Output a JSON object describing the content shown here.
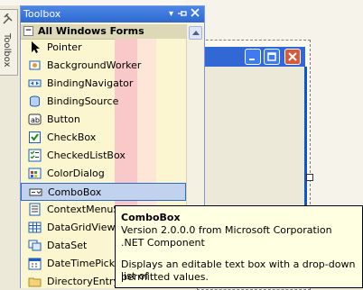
{
  "dock_tab": {
    "label": "Toolbox"
  },
  "toolbox": {
    "title": "Toolbox",
    "section": "All Windows Forms",
    "items": [
      {
        "label": "Pointer",
        "icon": "pointer-icon"
      },
      {
        "label": "BackgroundWorker",
        "icon": "background-worker-icon"
      },
      {
        "label": "BindingNavigator",
        "icon": "binding-navigator-icon"
      },
      {
        "label": "BindingSource",
        "icon": "binding-source-icon"
      },
      {
        "label": "Button",
        "icon": "button-icon"
      },
      {
        "label": "CheckBox",
        "icon": "checkbox-icon"
      },
      {
        "label": "CheckedListBox",
        "icon": "checked-listbox-icon"
      },
      {
        "label": "ColorDialog",
        "icon": "color-dialog-icon"
      },
      {
        "label": "ComboBox",
        "icon": "combobox-icon",
        "selected": true
      },
      {
        "label": "ContextMenuStrip",
        "icon": "context-menu-strip-icon"
      },
      {
        "label": "DataGridView",
        "icon": "datagridview-icon"
      },
      {
        "label": "DataSet",
        "icon": "dataset-icon"
      },
      {
        "label": "DateTimePicker",
        "icon": "datetimepicker-icon"
      },
      {
        "label": "DirectoryEntry",
        "icon": "directory-entry-icon"
      }
    ]
  },
  "tooltip": {
    "title": "ComboBox",
    "version": "Version 2.0.0.0 from Microsoft Corporation",
    "kind": ".NET Component",
    "desc_line1": "Displays an editable text box with a drop-down list of",
    "desc_line2": "permitted values."
  },
  "colors": {
    "title_bar": "#2f68d0",
    "selection": "#c1d2ee",
    "tooltip_bg": "#ffffe1"
  }
}
